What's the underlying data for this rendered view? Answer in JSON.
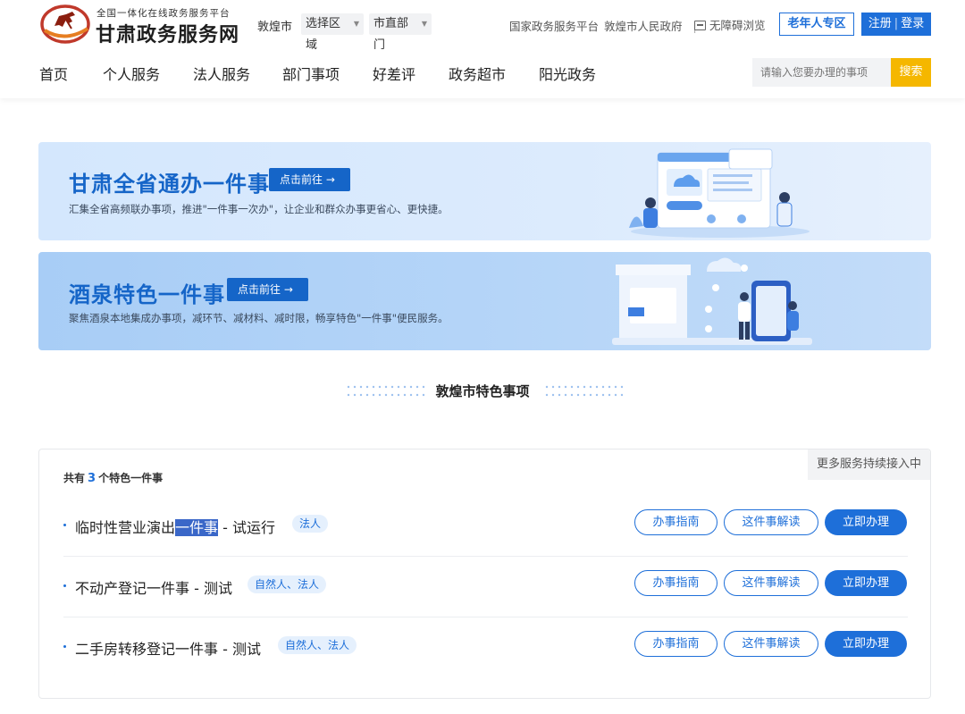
{
  "header": {
    "logo_sub": "全国一体化在线政务服务平台",
    "logo_main": "甘肃政务服务网",
    "region": "敦煌市",
    "region_select": "选择区域",
    "dept_select": "市直部门",
    "links": [
      "国家政务服务平台",
      "敦煌市人民政府"
    ],
    "a11y": "无障碍浏览",
    "elder": "老年人专区",
    "register": "注册",
    "login": "登录"
  },
  "nav": {
    "items": [
      "首页",
      "个人服务",
      "法人服务",
      "部门事项",
      "好差评",
      "政务超市",
      "阳光政务"
    ],
    "search_placeholder": "请输入您要办理的事项",
    "search_button": "搜索"
  },
  "banners": [
    {
      "title": "甘肃全省通办一件事",
      "button": "点击前往 →",
      "desc": "汇集全省高频联办事项，推进\"一件事一次办\"，让企业和群众办事更省心、更快捷。"
    },
    {
      "title": "酒泉特色一件事",
      "button": "点击前往 →",
      "desc": "聚焦酒泉本地集成办事项，减环节、减材料、减时限，畅享特色\"一件事\"便民服务。"
    }
  ],
  "section_title": "敦煌市特色事项",
  "card": {
    "more": "更多服务持续接入中",
    "count_prefix": "共有",
    "count": "3",
    "count_suffix": "个特色一件事",
    "items": [
      {
        "name_a": "临时性营业演出",
        "name_hl": "一件事",
        "name_b": " - 试运行",
        "tag": "法人"
      },
      {
        "name": "不动产登记一件事 - 测试",
        "tag": "自然人、法人"
      },
      {
        "name": "二手房转移登记一件事 - 测试",
        "tag": "自然人、法人"
      }
    ],
    "btn_guide": "办事指南",
    "btn_read": "这件事解读",
    "btn_do": "立即办理"
  },
  "colors": {
    "brand_blue": "#1e6fd9",
    "banner_blue": "#1565c8",
    "search_yellow": "#f5b700"
  }
}
